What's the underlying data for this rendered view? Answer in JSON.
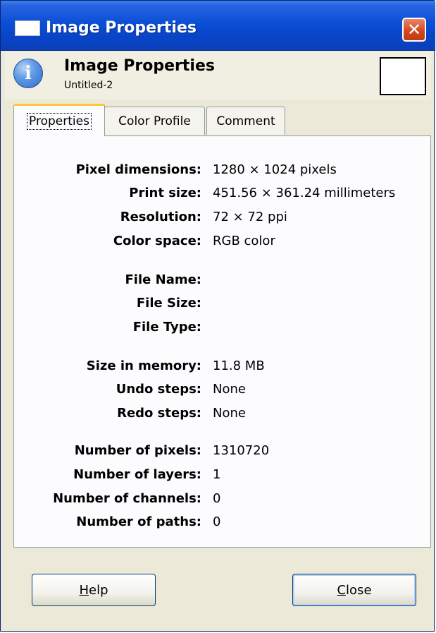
{
  "window": {
    "title": "Image Properties"
  },
  "header": {
    "title": "Image Properties",
    "subtitle": "Untitled-2"
  },
  "tabs": [
    {
      "label": "Properties",
      "active": true
    },
    {
      "label": "Color Profile",
      "active": false
    },
    {
      "label": "Comment",
      "active": false
    }
  ],
  "properties": {
    "pixel_dimensions": {
      "label": "Pixel dimensions:",
      "value": "1280 × 1024 pixels"
    },
    "print_size": {
      "label": "Print size:",
      "value": "451.56 × 361.24 millimeters"
    },
    "resolution": {
      "label": "Resolution:",
      "value": "72 × 72 ppi"
    },
    "color_space": {
      "label": "Color space:",
      "value": "RGB color"
    },
    "file_name": {
      "label": "File Name:",
      "value": ""
    },
    "file_size": {
      "label": "File Size:",
      "value": ""
    },
    "file_type": {
      "label": "File Type:",
      "value": ""
    },
    "size_in_memory": {
      "label": "Size in memory:",
      "value": "11.8 MB"
    },
    "undo_steps": {
      "label": "Undo steps:",
      "value": "None"
    },
    "redo_steps": {
      "label": "Redo steps:",
      "value": "None"
    },
    "num_pixels": {
      "label": "Number of pixels:",
      "value": "1310720"
    },
    "num_layers": {
      "label": "Number of layers:",
      "value": "1"
    },
    "num_channels": {
      "label": "Number of channels:",
      "value": "0"
    },
    "num_paths": {
      "label": "Number of paths:",
      "value": "0"
    }
  },
  "buttons": {
    "help": {
      "mnemonic": "H",
      "rest": "elp"
    },
    "close": {
      "mnemonic": "C",
      "rest": "lose"
    }
  },
  "colors": {
    "titlebar": "#0a4fd6",
    "close_button": "#d3491f",
    "dialog_bg": "#ece9d8",
    "panel_bg": "#fcfcfe",
    "active_tab_accent": "#ffc83c"
  },
  "icons": {
    "window": "window-icon",
    "close": "close-icon",
    "header": "info-icon"
  }
}
